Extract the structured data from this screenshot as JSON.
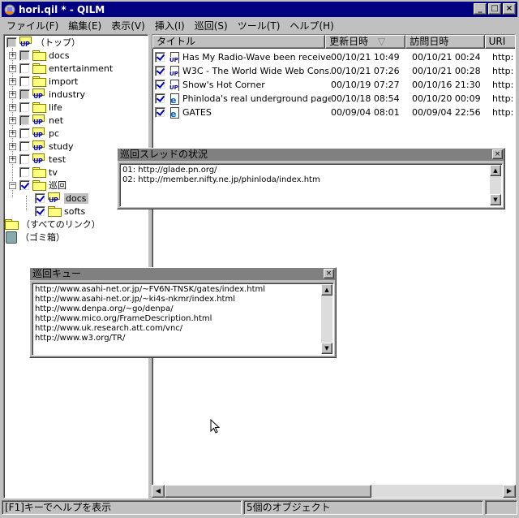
{
  "window": {
    "title": "hori.qil * - QILM",
    "minimize": "_",
    "maximize": "□",
    "close": "×"
  },
  "menu": [
    "ファイル(F)",
    "編集(E)",
    "表示(V)",
    "挿入(I)",
    "巡回(S)",
    "ツール(T)",
    "ヘルプ(H)"
  ],
  "tree": {
    "root": "（トップ）",
    "folders": [
      "docs",
      "entertainment",
      "import",
      "industry",
      "life",
      "net",
      "pc",
      "study",
      "test",
      "tv",
      "巡回"
    ],
    "sub": [
      "docs",
      "softs"
    ],
    "all_links": "（すべてのリンク）",
    "trash": "（ゴミ箱）"
  },
  "list": {
    "columns": [
      "タイトル",
      "更新日時",
      "訪問日時",
      "URI"
    ],
    "sort_indicator": "▽",
    "rows": [
      {
        "title": "Has My Radio-Wave been receive...",
        "updated": "00/10/21 10:49",
        "visited": "00/10/21 00:24",
        "uri": "http:"
      },
      {
        "title": "W3C - The World Wide Web Cons...",
        "updated": "00/10/21 07:26",
        "visited": "00/10/21 00:28",
        "uri": "http:"
      },
      {
        "title": "Show's Hot Corner",
        "updated": "00/10/19 07:27",
        "visited": "00/10/16 21:30",
        "uri": "http:"
      },
      {
        "title": "Phinloda's real underground page",
        "updated": "00/10/18 08:54",
        "visited": "00/10/20 00:09",
        "uri": "http:"
      },
      {
        "title": "GATES",
        "updated": "00/09/04 08:01",
        "visited": "00/09/04 22:56",
        "uri": "http:"
      }
    ]
  },
  "thread_panel": {
    "title": "巡回スレッドの状況",
    "lines": [
      "01: http://glade.pn.org/",
      "02: http://member.nifty.ne.jp/phinloda/index.htm"
    ]
  },
  "queue_panel": {
    "title": "巡回キュー",
    "lines": [
      "http://www.asahi-net.or.jp/~FV6N-TNSK/gates/index.html",
      "http://www.asahi-net.or.jp/~ki4s-nkmr/index.html",
      "http://www.denpa.org/~go/denpa/",
      "http://www.mico.org/FrameDescription.html",
      "http://www.uk.research.att.com/vnc/",
      "http://www.w3.org/TR/"
    ]
  },
  "status": {
    "help": "[F1]キーでヘルプを表示",
    "count": "5個のオブジェクト"
  },
  "colors": {
    "titlebar": "#000080",
    "panel_title": "#808080",
    "face": "#c0c0c0"
  }
}
